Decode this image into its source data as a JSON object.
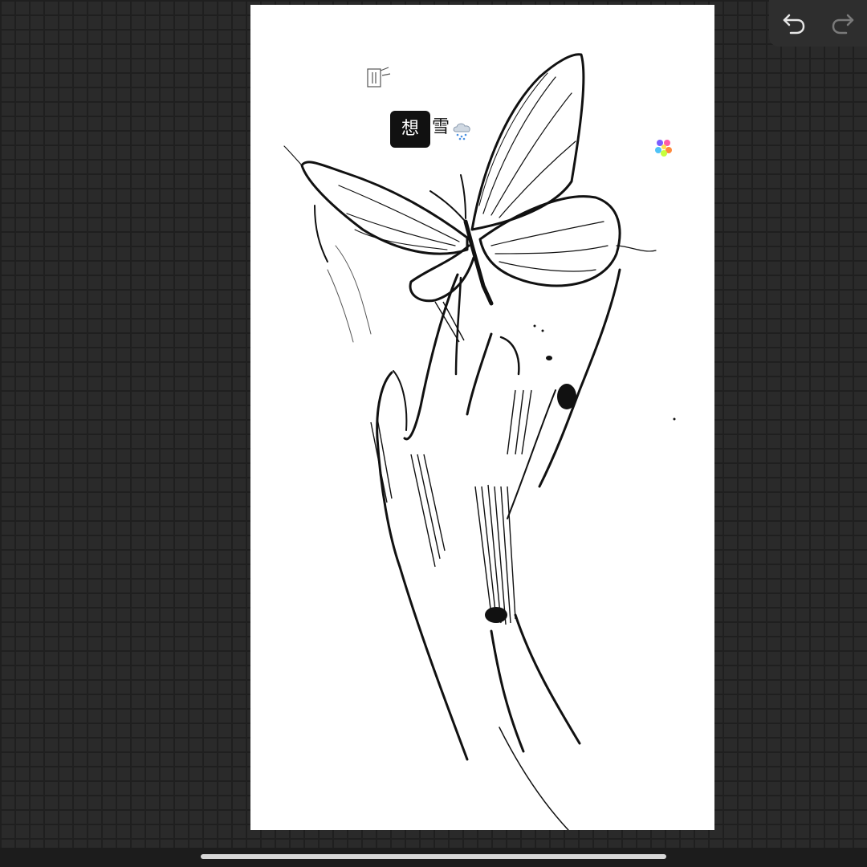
{
  "app": {
    "toolbar": {
      "undo_icon": "undo-arrow-icon",
      "redo_icon": "redo-arrow-icon",
      "undo_enabled": true,
      "redo_enabled": false
    }
  },
  "canvas": {
    "background": "#ffffff",
    "stickers": {
      "box_char": "想",
      "text": "雪",
      "weather_icon": "snow-cloud-icon",
      "flower_icon": "flower-icon",
      "doodle_icon": "doodle-sketch-icon"
    },
    "artwork_subject_icons": [
      "butterfly-sketch",
      "hand-sketch"
    ]
  },
  "colors": {
    "workspace": "#2a2a2a",
    "grid": "#1f1f1f",
    "ink": "#111111",
    "panel": "#2e2e2e",
    "home_indicator": "#d7d7d7"
  }
}
